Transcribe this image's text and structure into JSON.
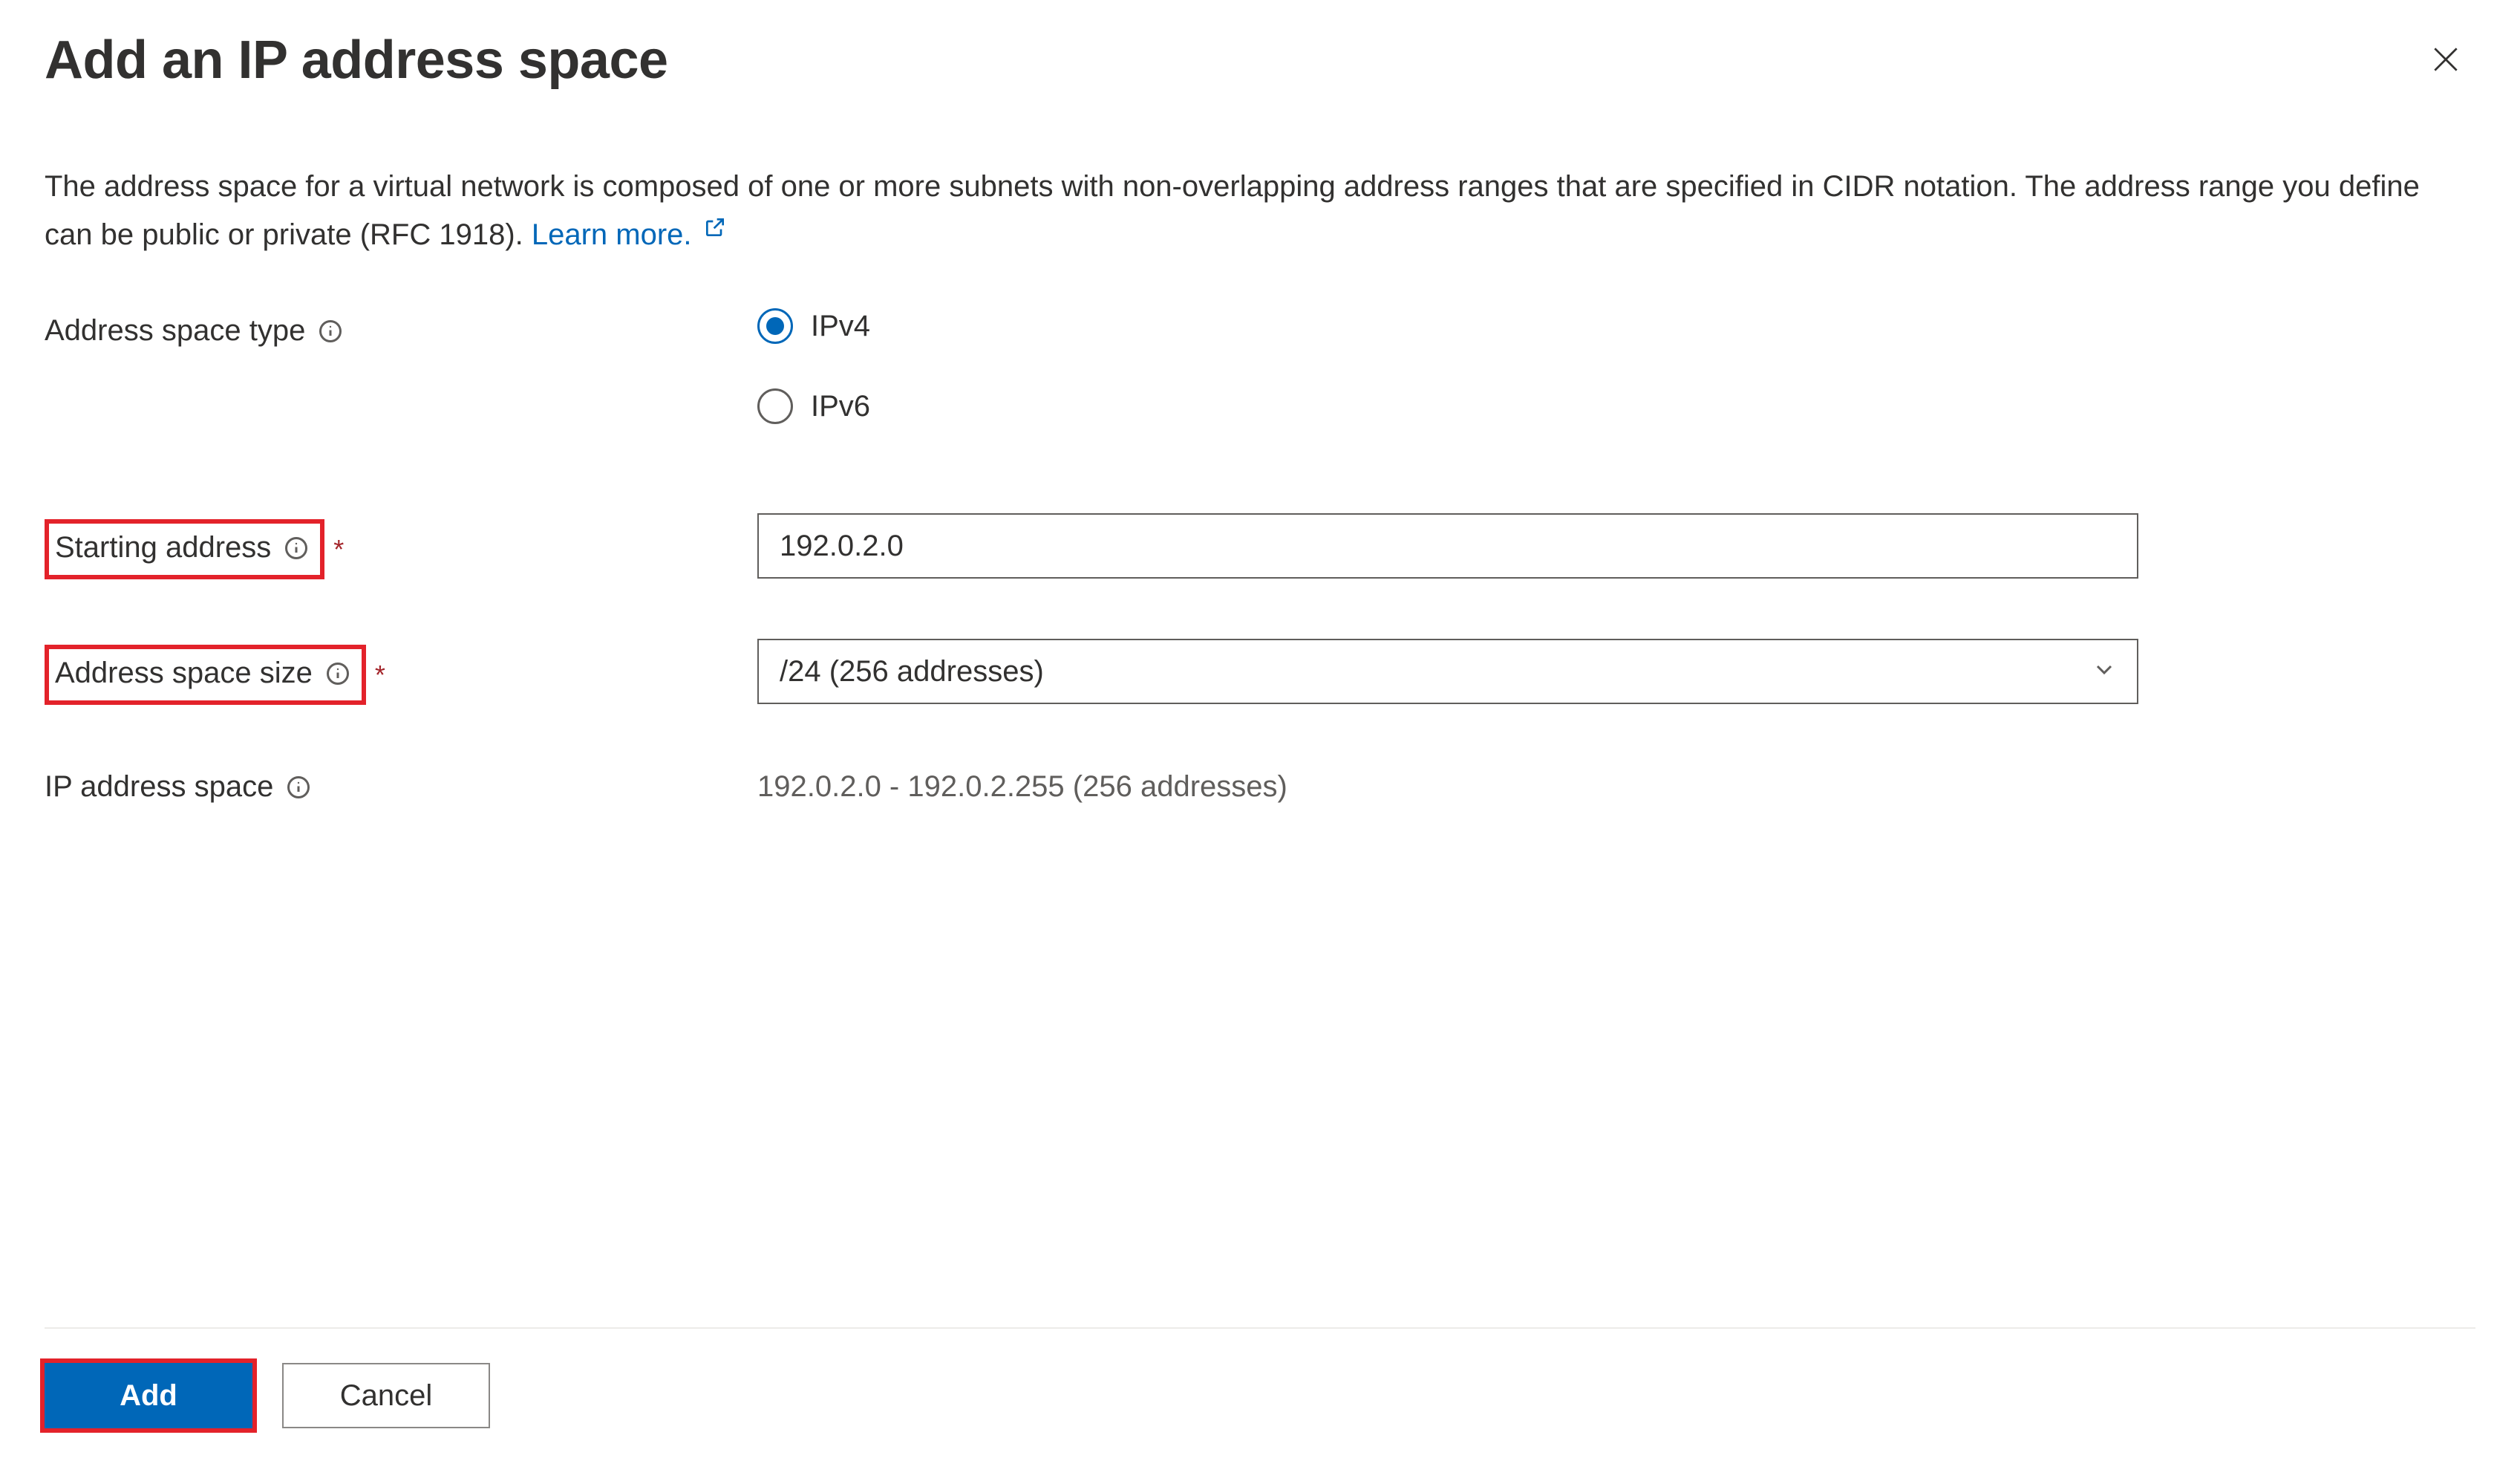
{
  "header": {
    "title": "Add an IP address space"
  },
  "description": {
    "text_before_link": "The address space for a virtual network is composed of one or more subnets with non-overlapping address ranges that are specified in CIDR notation. The address range you define can be public or private (RFC 1918). ",
    "link_text": "Learn more."
  },
  "form": {
    "address_space_type": {
      "label": "Address space type",
      "options": {
        "ipv4": "IPv4",
        "ipv6": "IPv6"
      },
      "selected": "ipv4"
    },
    "starting_address": {
      "label": "Starting address",
      "value": "192.0.2.0"
    },
    "address_space_size": {
      "label": "Address space size",
      "value": "/24 (256 addresses)"
    },
    "ip_address_space": {
      "label": "IP address space",
      "value": "192.0.2.0 - 192.0.2.255 (256 addresses)"
    }
  },
  "footer": {
    "add_label": "Add",
    "cancel_label": "Cancel"
  }
}
